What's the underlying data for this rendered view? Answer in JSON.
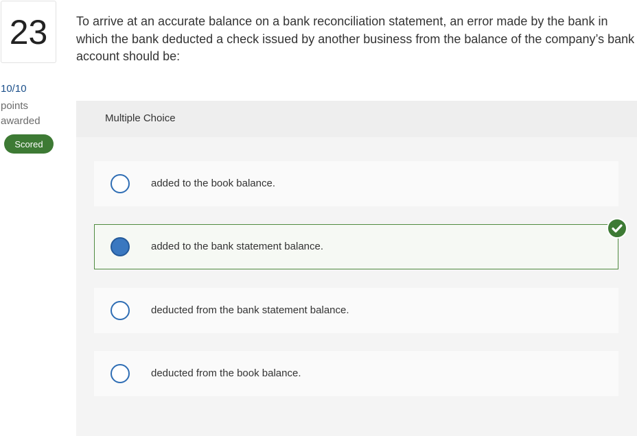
{
  "question": {
    "number": "23",
    "text": "To arrive at an accurate balance on a bank reconciliation statement, an error made by the bank in which the bank deducted a check issued by another business from the balance of the company’s bank account should be:"
  },
  "score": {
    "value": "10/10",
    "label": "points awarded",
    "badge": "Scored"
  },
  "multiple_choice": {
    "header": "Multiple Choice",
    "options": [
      {
        "label": "added to the book balance.",
        "selected": false
      },
      {
        "label": "added to the bank statement balance.",
        "selected": true,
        "correct": true
      },
      {
        "label": "deducted from the bank statement balance.",
        "selected": false
      },
      {
        "label": "deducted from the book balance.",
        "selected": false
      }
    ]
  },
  "colors": {
    "accent_blue": "#2e6db4",
    "correct_green": "#3d7a34"
  },
  "icons": {
    "correct": "check-circle-icon"
  }
}
